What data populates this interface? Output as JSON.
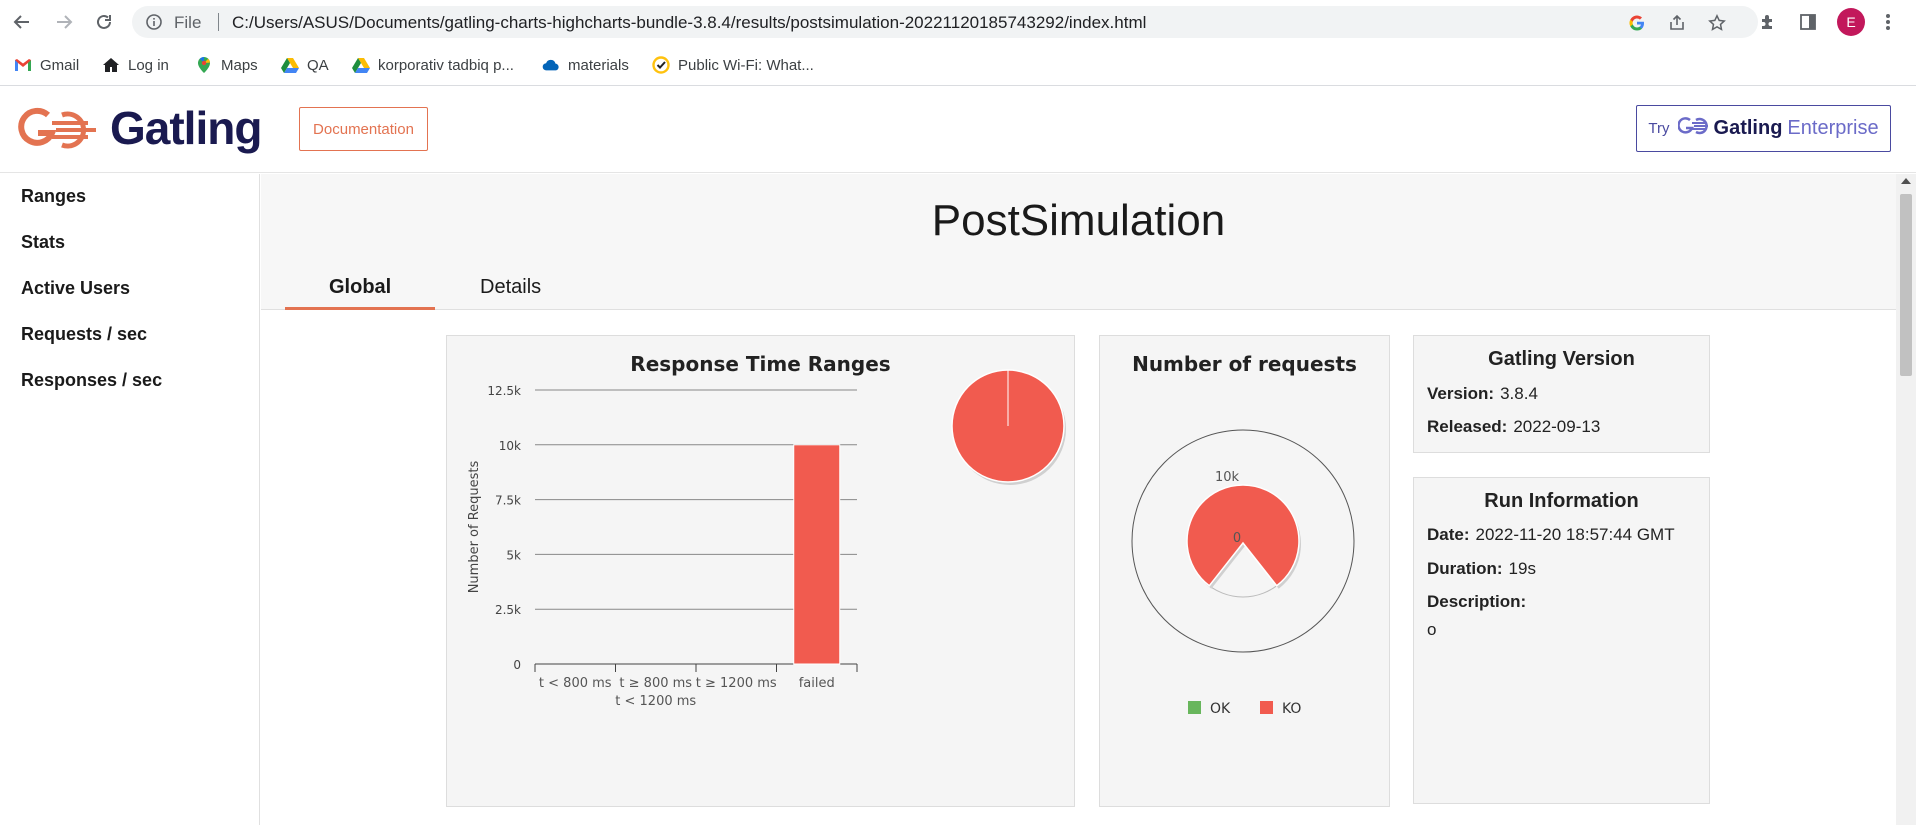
{
  "browser": {
    "file_label": "File",
    "url": "C:/Users/ASUS/Documents/gatling-charts-highcharts-bundle-3.8.4/results/postsimulation-20221120185743292/index.html",
    "profile_initial": "E",
    "bookmarks": [
      {
        "label": "Gmail",
        "icon": "gmail-icon"
      },
      {
        "label": "Log in",
        "icon": "home-icon"
      },
      {
        "label": "Maps",
        "icon": "maps-icon"
      },
      {
        "label": "QA",
        "icon": "drive-icon"
      },
      {
        "label": "korporativ tadbiq p...",
        "icon": "drive-icon"
      },
      {
        "label": "materials",
        "icon": "onedrive-icon"
      },
      {
        "label": "Public Wi-Fi: What...",
        "icon": "norton-icon"
      }
    ]
  },
  "header": {
    "logo_text": "Gatling",
    "documentation_label": "Documentation",
    "enterprise": {
      "try": "Try",
      "brand": "Gatling",
      "suffix": "Enterprise"
    }
  },
  "sidebar": {
    "items": [
      {
        "label": "Ranges"
      },
      {
        "label": "Stats"
      },
      {
        "label": "Active Users"
      },
      {
        "label": "Requests / sec"
      },
      {
        "label": "Responses / sec"
      }
    ]
  },
  "simulation": {
    "title": "PostSimulation",
    "tabs": [
      {
        "label": "Global",
        "active": true
      },
      {
        "label": "Details",
        "active": false
      }
    ]
  },
  "chart_data": [
    {
      "type": "bar",
      "title": "Response Time Ranges",
      "ylabel": "Number of Requests",
      "xlabel": "",
      "categories": [
        "t < 800 ms",
        "t ≥ 800 ms\nt < 1200 ms",
        "t ≥ 1200 ms",
        "failed"
      ],
      "values": [
        0,
        0,
        0,
        10000
      ],
      "ylim": [
        0,
        12500
      ],
      "yticks": [
        "0",
        "2.5k",
        "5k",
        "7.5k",
        "10k",
        "12.5k"
      ],
      "grid": true,
      "colors": [
        "#68b65c",
        "#ffdd00",
        "#f15b4f",
        "#f15b4f"
      ],
      "inset_pie": {
        "values": [
          0,
          0,
          0,
          10000
        ],
        "color": "#f15b4f"
      }
    },
    {
      "type": "pie",
      "title": "Number of requests",
      "series": [
        {
          "name": "OK",
          "value": 0,
          "color": "#68b65c"
        },
        {
          "name": "KO",
          "value": 10000,
          "color": "#f15b4f"
        }
      ],
      "labels": [
        "10k",
        "0"
      ],
      "legend": "bottom"
    }
  ],
  "gatling_version": {
    "title": "Gatling Version",
    "version_key": "Version:",
    "version": "3.8.4",
    "released_key": "Released:",
    "released": "2022-09-13"
  },
  "run_info": {
    "title": "Run Information",
    "date_key": "Date:",
    "date": "2022-11-20 18:57:44 GMT",
    "duration_key": "Duration:",
    "duration": "19s",
    "description_key": "Description:",
    "description": "o"
  },
  "colors": {
    "accent": "#e37351",
    "brand_dark": "#1a1a50",
    "ko": "#f15b4f",
    "ok": "#68b65c"
  }
}
